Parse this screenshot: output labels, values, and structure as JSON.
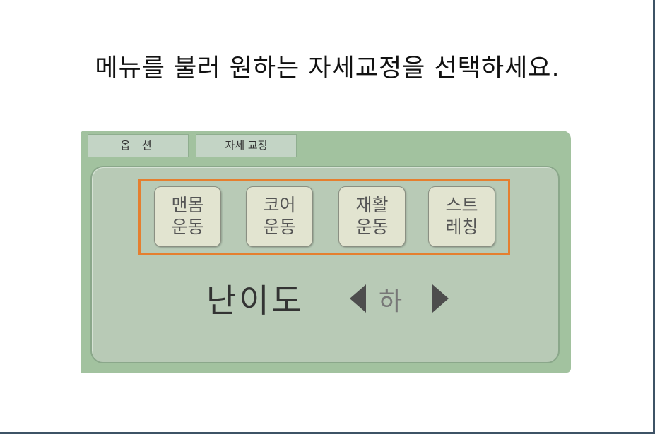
{
  "instruction": "메뉴를 불러 원하는 자세교정을 선택하세요.",
  "tabs": {
    "options": "옵 션",
    "posture": "자세 교정"
  },
  "menu": [
    {
      "line1": "맨몸",
      "line2": "운동"
    },
    {
      "line1": "코어",
      "line2": "운동"
    },
    {
      "line1": "재활",
      "line2": "운동"
    },
    {
      "line1": "스트",
      "line2": "레칭"
    }
  ],
  "difficulty": {
    "label": "난이도",
    "value": "하"
  },
  "colors": {
    "panel": "#a2c29f",
    "inner_panel": "#b8cab6",
    "highlight": "#e57f2f",
    "frame_border": "#3e5366"
  }
}
